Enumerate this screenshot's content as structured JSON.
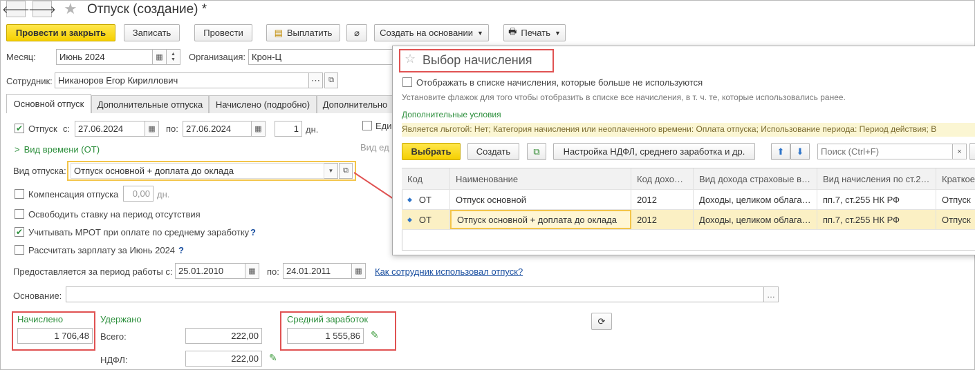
{
  "window": {
    "title": "Отпуск (создание) *",
    "star": "☆"
  },
  "toolbar": {
    "post_close": "Провести и закрыть",
    "save": "Записать",
    "post": "Провести",
    "pay": "Выплатить",
    "create_based": "Создать на основании",
    "print": "Печать"
  },
  "form": {
    "month_label": "Месяц:",
    "month_value": "Июнь 2024",
    "org_label": "Организация:",
    "org_value": "Крон-Ц",
    "employee_label": "Сотрудник:",
    "employee_value": "Никаноров Егор Кириллович"
  },
  "tabs": [
    "Основной отпуск",
    "Дополнительные отпуска",
    "Начислено (подробно)",
    "Дополнительно"
  ],
  "vacation": {
    "label": "Отпуск",
    "from_label": "с:",
    "from_value": "27.06.2024",
    "to_label": "по:",
    "to_value": "27.06.2024",
    "days_value": "1",
    "days_unit": "дн.",
    "time_type": "Вид времени (ОТ)",
    "type_label": "Вид отпуска:",
    "type_value": "Отпуск основной + доплата до оклада",
    "compensation_label": "Компенсация отпуска",
    "compensation_value": "0,00",
    "compensation_unit": "дн.",
    "free_rate": "Освободить ставку на период отсутствия",
    "mrot": "Учитывать МРОТ при оплате по среднему заработку",
    "calc_salary": "Рассчитать зарплату за Июнь 2024",
    "help": "?",
    "period_label": "Предоставляется за период работы с:",
    "period_from": "25.01.2010",
    "period_to_label": "по:",
    "period_to": "24.01.2011",
    "usage_link": "Как сотрудник использовал отпуск?",
    "basis_label": "Основание:",
    "basis_value": "",
    "right_col_1": "Еди",
    "right_col_2": "Вид ед"
  },
  "totals": {
    "accrued_label": "Начислено",
    "accrued_value": "1 706,48",
    "withheld_label": "Удержано",
    "total_label": "Всего:",
    "total_value": "222,00",
    "ndfl_label": "НДФЛ:",
    "ndfl_value": "222,00",
    "avg_label": "Средний заработок",
    "avg_value": "1 555,86"
  },
  "popup": {
    "title": "Выбор начисления",
    "show_unused": "Отображать в списке начисления, которые больше не используются",
    "hint": "Установите флажок для того чтобы отобразить в списке все начисления, в т. ч. те, которые использовались ранее.",
    "extra_title": "Дополнительные условия",
    "extra_text": "Является льготой: Нет; Категория начисления или неоплаченного времени: Оплата отпуска; Использование периода: Период действия; В",
    "select": "Выбрать",
    "create": "Создать",
    "ndfl_settings": "Настройка НДФЛ, среднего заработка и др.",
    "search_placeholder": "Поиск (Ctrl+F)",
    "columns": [
      "Код",
      "Наименование",
      "Код дохо…",
      "Вид дохода страховые в…",
      "Вид начисления по ст.2…",
      "Краткое"
    ],
    "rows": [
      [
        "ОТ",
        "Отпуск основной",
        "2012",
        "Доходы, целиком облага…",
        "пп.7, ст.255 НК РФ",
        "Отпуск"
      ],
      [
        "ОТ",
        "Отпуск основной + доплата до оклада",
        "2012",
        "Доходы, целиком облага…",
        "пп.7, ст.255 НК РФ",
        "Отпуск"
      ]
    ]
  }
}
